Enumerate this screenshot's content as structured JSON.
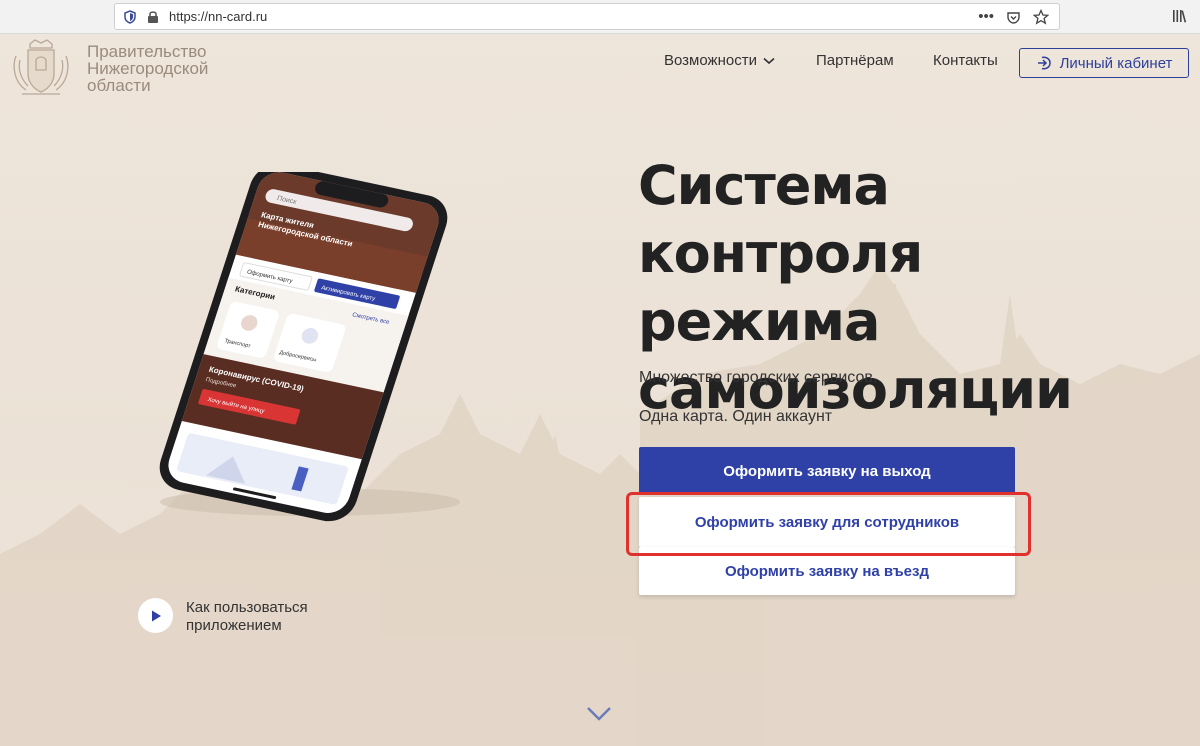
{
  "browser": {
    "url": "https://nn-card.ru"
  },
  "header": {
    "gov_line1": "Правительство",
    "gov_line2": "Нижегородской",
    "gov_line3": "области",
    "nav": {
      "features": "Возможности",
      "partners": "Партнёрам",
      "contacts": "Контакты"
    },
    "cabinet": "Личный кабинет"
  },
  "hero": {
    "title_line1": "Система",
    "title_line2": "контроля режима",
    "title_line3": "самоизоляции",
    "subtitle1": "Множество городских сервисов.",
    "subtitle2": "Одна карта. Один аккаунт"
  },
  "buttons": {
    "exit": "Оформить заявку на выход",
    "staff": "Оформить заявку для сотрудников",
    "entry": "Оформить заявку на въезд"
  },
  "how_to": {
    "line1": "Как пользоваться",
    "line2": "приложением"
  },
  "phone_screen": {
    "search": "Поиск",
    "card_title_1": "Карта жителя",
    "card_title_2": "Нижегородской области",
    "card_btn_issue": "Оформить карту",
    "card_btn_activate": "Активировать карту",
    "categories": "Категории",
    "see_all": "Смотреть все",
    "cat_transport": "Транспорт",
    "cat_good": "Добросервисы",
    "covid": "Коронавирус (COVID-19)",
    "covid_more": "Подробнее",
    "go_out": "Хочу выйти на улицу"
  },
  "colors": {
    "primary": "#2f41a6",
    "highlight": "#e0312f",
    "background": "#ede3d8"
  }
}
